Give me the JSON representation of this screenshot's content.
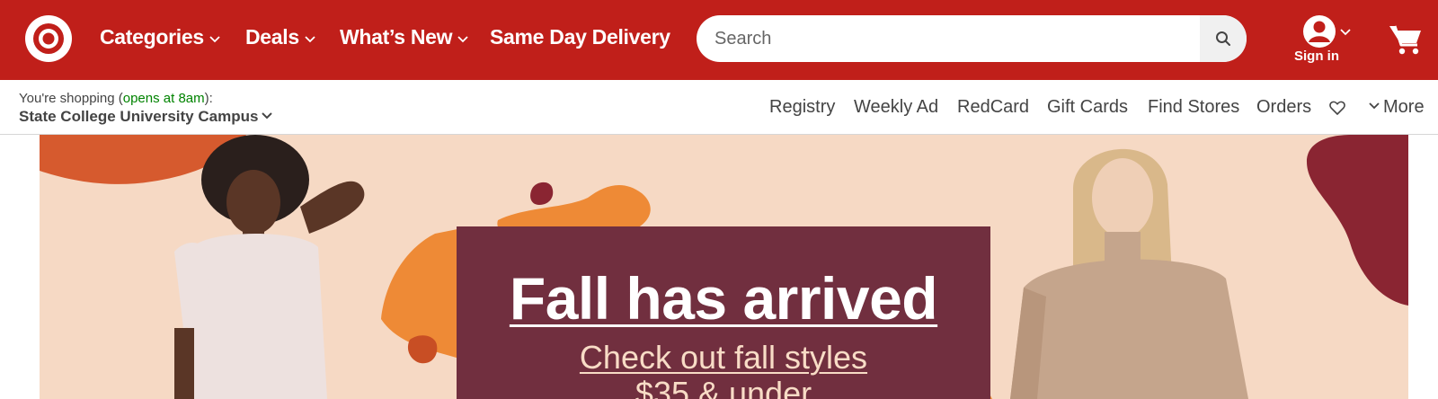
{
  "header": {
    "nav": [
      {
        "label": "Categories",
        "has_dropdown": true
      },
      {
        "label": "Deals",
        "has_dropdown": true
      },
      {
        "label": "What’s New",
        "has_dropdown": true
      },
      {
        "label": "Same Day Delivery",
        "has_dropdown": false
      }
    ],
    "search": {
      "placeholder": "Search",
      "value": ""
    },
    "account": {
      "label": "Sign in"
    },
    "icons": {
      "logo": "target-bullseye-logo",
      "search": "search-icon",
      "account": "user-avatar-icon",
      "cart": "shopping-cart-icon"
    }
  },
  "store": {
    "prefix": "You're shopping (",
    "status": "opens at 8am",
    "suffix": "):",
    "name": "State College University Campus"
  },
  "utility_nav": {
    "items": [
      "Registry",
      "Weekly Ad",
      "RedCard",
      "Gift Cards",
      "Find Stores",
      "Orders"
    ],
    "favorites_icon": "heart-icon",
    "more_label": "More"
  },
  "hero": {
    "title": "Fall has arrived",
    "subtitle_line1": "Check out fall styles",
    "subtitle_line2": "$35 & under"
  },
  "colors": {
    "brand_red": "#c01f1a",
    "promo_box": "#712f3f",
    "hero_background": "#f6d9c4",
    "store_open_status": "#008300"
  }
}
